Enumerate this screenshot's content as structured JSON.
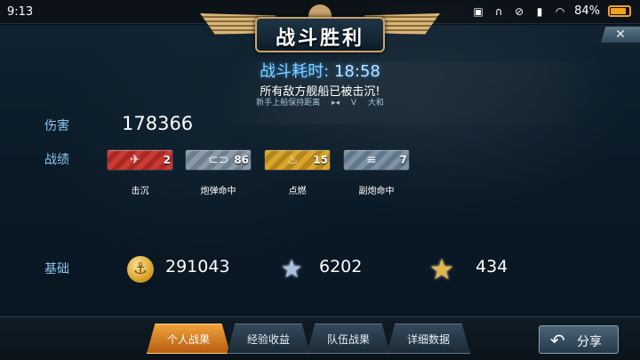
{
  "status_bar": {
    "time": "9:13",
    "battery": "84%"
  },
  "header": {
    "title": "战斗胜利",
    "close_label": "✕"
  },
  "battle": {
    "duration_label": "战斗耗时:",
    "duration_value": "18:58",
    "message": "所有敌方舰船已被击沉!",
    "tip_left": "新手上船保持距离",
    "tip_mid": "V",
    "tip_right": "大和"
  },
  "stats": {
    "damage_label": "伤害",
    "damage_value": "178366",
    "record_label": "战绩",
    "medals": [
      {
        "label": "击沉",
        "count": "2",
        "color": "#c93a33",
        "icon": "plane-icon"
      },
      {
        "label": "炮弹命中",
        "count": "86",
        "color": "#8a9aa8",
        "icon": "shell-icon"
      },
      {
        "label": "点燃",
        "count": "15",
        "color": "#d9a62c",
        "icon": "fire-icon"
      },
      {
        "label": "副炮命中",
        "count": "7",
        "color": "#7f92a3",
        "icon": "secondary-gun-icon"
      }
    ],
    "base_label": "基础",
    "resources": [
      {
        "icon": "coin-icon",
        "value": "291043"
      },
      {
        "icon": "silver-star-icon",
        "value": "6202"
      },
      {
        "icon": "gold-star-icon",
        "value": "434"
      }
    ]
  },
  "tabs": [
    {
      "label": "个人战果",
      "active": true
    },
    {
      "label": "经验收益",
      "active": false
    },
    {
      "label": "队伍战果",
      "active": false
    },
    {
      "label": "详细数据",
      "active": false
    }
  ],
  "share": {
    "label": "分享"
  }
}
